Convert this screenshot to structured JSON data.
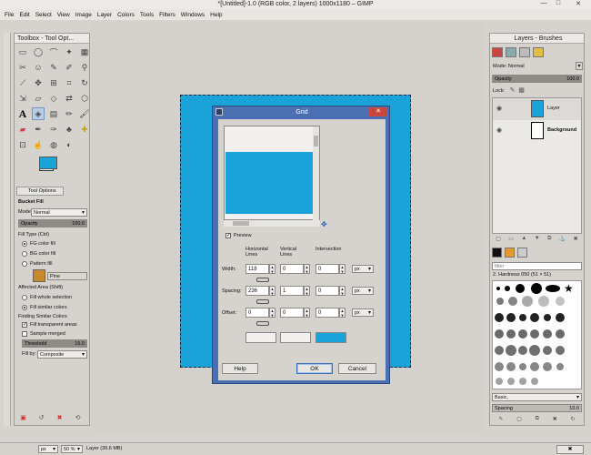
{
  "window": {
    "title": "*[Untitled]-1.0 (RGB color, 2 layers) 1000x1180 – GIMP",
    "min": "—",
    "max": "□",
    "close": "✕"
  },
  "menu": [
    "File",
    "Edit",
    "Select",
    "View",
    "Image",
    "Layer",
    "Colors",
    "Tools",
    "Filters",
    "Windows",
    "Help"
  ],
  "toolbox": {
    "title": "Toolbox - Tool Opt...",
    "tab_label": "Tool Options",
    "tool_name": "Bucket Fill",
    "mode_label": "Mode:",
    "mode_value": "Normal",
    "opacity_label": "Opacity",
    "opacity_value": "100.0",
    "filltype_label": "Fill Type  (Ctrl)",
    "fill_options": [
      "FG color fill",
      "BG color fill",
      "Pattern fill"
    ],
    "pattern_name": "Pine",
    "affected_label": "Affected Area  (Shift)",
    "affected_options": [
      "Fill whole selection",
      "Fill similar colors"
    ],
    "finding_label": "Finding Similar Colors",
    "fill_transparent": "Fill transparent areas",
    "sample_merged": "Sample merged",
    "threshold_label": "Threshold",
    "threshold_value": "15.0",
    "fillby_label": "Fill by:",
    "fillby_value": "Composite"
  },
  "dialog": {
    "title": "Grid",
    "preview_label": "Preview",
    "hlines": "Horizontal\nLines",
    "vlines": "Vertical\nLines",
    "intersection": "Intersection",
    "width_label": "Width:",
    "spacing_label": "Spacing:",
    "offset_label": "Offset:",
    "width_vals": [
      "118",
      "0",
      "0"
    ],
    "spacing_vals": [
      "236",
      "1",
      "0"
    ],
    "offset_vals": [
      "0",
      "0",
      "0"
    ],
    "unit": "px",
    "help": "Help",
    "ok": "OK",
    "cancel": "Cancel",
    "colors": {
      "c1": "#f2f0ee",
      "c2": "#f2f0ee",
      "c3": "#1aa3d8"
    }
  },
  "layers": {
    "title": "Layers - Brushes",
    "mode_label": "Mode:",
    "mode_value": "Normal",
    "opacity_label": "Opacity",
    "opacity_value": "100.0",
    "lock_label": "Lock:",
    "items": [
      {
        "name": "Layer",
        "color": "#1aa3d8"
      },
      {
        "name": "Background",
        "color": "#ffffff"
      }
    ],
    "filter_placeholder": "filter",
    "brush_name": "2. Hardness 050 (51 × 51)",
    "brush_set": "Basic,",
    "spacing_label": "Spacing",
    "spacing_value": "10.0"
  },
  "status": {
    "unit": "px",
    "zoom": "50 %",
    "info": "Layer (39.6 MB)"
  },
  "colors": {
    "accent": "#1aa3d8",
    "dialog_frame": "#4a6fb3",
    "close_red": "#c9463d"
  }
}
